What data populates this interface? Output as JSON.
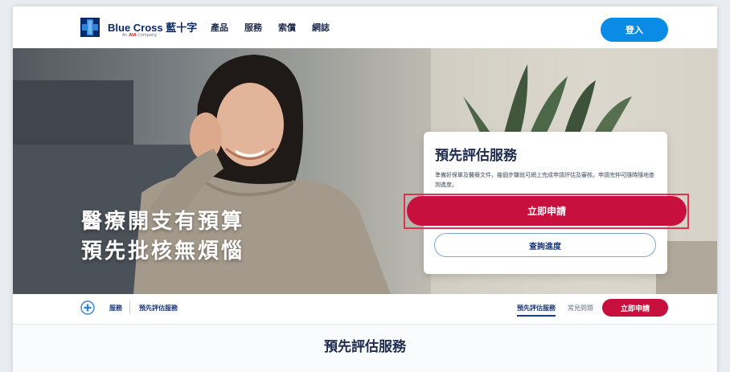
{
  "header": {
    "logo_text": "Blue Cross 藍十字",
    "logo_tag_brand": "AIA",
    "logo_tag_prefix": "An ",
    "logo_tag_suffix": " Company",
    "nav": [
      "產品",
      "服務",
      "索償",
      "網誌"
    ],
    "login_label": "登入"
  },
  "hero": {
    "headline_line1": "醫療開支有預算",
    "headline_line2": "預先批核無煩惱"
  },
  "card": {
    "title": "預先評估服務",
    "description": "準備好保單及醫療文件，幾個步驟就可網上完成申請評估及審核。申請完仲可隨時隨地查詢進度。",
    "apply_label": "立即申請",
    "query_label": "查詢進度"
  },
  "subnav": {
    "crumb_1": "服務",
    "crumb_2": "預先評估服務",
    "link_active": "預先評估服務",
    "link_faq": "常見問題",
    "apply_label": "立即申請"
  },
  "section": {
    "title": "預先評估服務"
  },
  "colors": {
    "primary_blue": "#0a8ce6",
    "apply_red": "#c8103f",
    "navy": "#1d2b4f"
  },
  "icons": {
    "logo": "blue-cross-logo-icon",
    "breadcrumb": "shield-plus-icon"
  }
}
